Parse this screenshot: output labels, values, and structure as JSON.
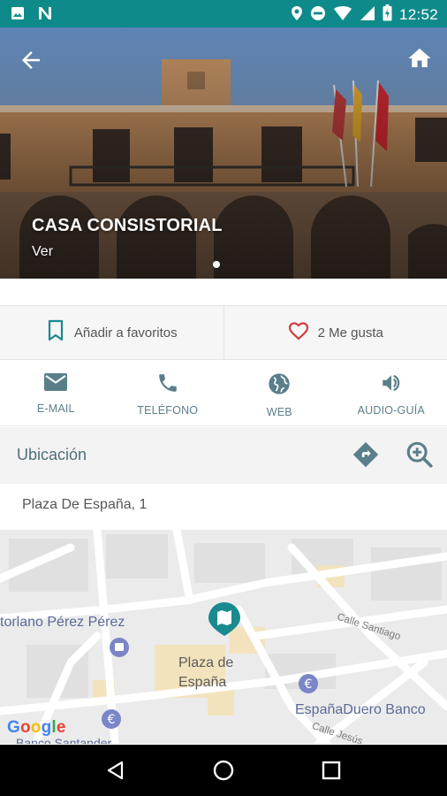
{
  "status_bar": {
    "time": "12:52",
    "icons": [
      "image-icon",
      "n-app-icon",
      "location-icon",
      "do-not-disturb-icon",
      "wifi-icon",
      "signal-icon",
      "battery-icon"
    ]
  },
  "hero": {
    "title": "CASA CONSISTORIAL",
    "subtitle": "Ver",
    "back_icon": "arrow-back-icon",
    "home_icon": "home-icon"
  },
  "actions": {
    "favorites_label": "Añadir a favoritos",
    "likes_label": "2 Me gusta"
  },
  "contact": [
    {
      "label": "E-MAIL",
      "icon": "email-icon"
    },
    {
      "label": "TELÉFONO",
      "icon": "phone-icon"
    },
    {
      "label": "WEB",
      "icon": "globe-icon"
    },
    {
      "label": "AUDIO-GUÍA",
      "icon": "speaker-icon"
    }
  ],
  "location": {
    "header": "Ubicación",
    "address": "Plaza De España, 1"
  },
  "map": {
    "labels": {
      "poi_left": "torlano Pérez Pérez",
      "plaza": "Plaza de España",
      "bank1": "EspañaDuero Banco",
      "bank2": "Banco Santander",
      "street1": "Calle Santiago",
      "street2": "Calle Jesús",
      "google": "Google"
    }
  },
  "colors": {
    "status_bar": "#0f8a8a",
    "accent_teal": "#1a8a8f",
    "icon_gray": "#5b7f8a",
    "heart_red": "#d33b3b"
  }
}
